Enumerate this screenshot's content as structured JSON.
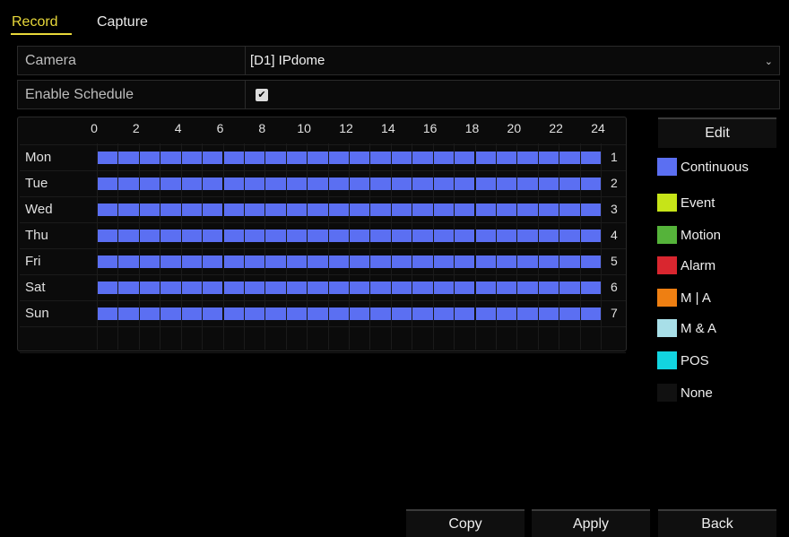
{
  "tabs": [
    {
      "label": "Record",
      "active": true
    },
    {
      "label": "Capture",
      "active": false
    }
  ],
  "camera": {
    "label": "Camera",
    "value": "[D1] IPdome"
  },
  "enable_schedule": {
    "label": "Enable Schedule",
    "checked": true
  },
  "schedule": {
    "hours": [
      "0",
      "2",
      "4",
      "6",
      "8",
      "10",
      "12",
      "14",
      "16",
      "18",
      "20",
      "22",
      "24"
    ],
    "days": [
      {
        "name": "Mon",
        "index": "1",
        "mode": "Continuous"
      },
      {
        "name": "Tue",
        "index": "2",
        "mode": "Continuous"
      },
      {
        "name": "Wed",
        "index": "3",
        "mode": "Continuous"
      },
      {
        "name": "Thu",
        "index": "4",
        "mode": "Continuous"
      },
      {
        "name": "Fri",
        "index": "5",
        "mode": "Continuous"
      },
      {
        "name": "Sat",
        "index": "6",
        "mode": "Continuous"
      },
      {
        "name": "Sun",
        "index": "7",
        "mode": "Continuous"
      }
    ]
  },
  "edit_button": "Edit",
  "legend": [
    {
      "label": "Continuous",
      "color": "#5b6ff2"
    },
    {
      "label": "Event",
      "color": "#c6e418"
    },
    {
      "label": "Motion",
      "color": "#55b33a"
    },
    {
      "label": "Alarm",
      "color": "#d9262f"
    },
    {
      "label": "M | A",
      "color": "#ee7f12"
    },
    {
      "label": "M & A",
      "color": "#a8dfe8"
    },
    {
      "label": "POS",
      "color": "#12d4e0"
    },
    {
      "label": "None",
      "color": "#111111"
    }
  ],
  "buttons": {
    "copy": "Copy",
    "apply": "Apply",
    "back": "Back"
  }
}
